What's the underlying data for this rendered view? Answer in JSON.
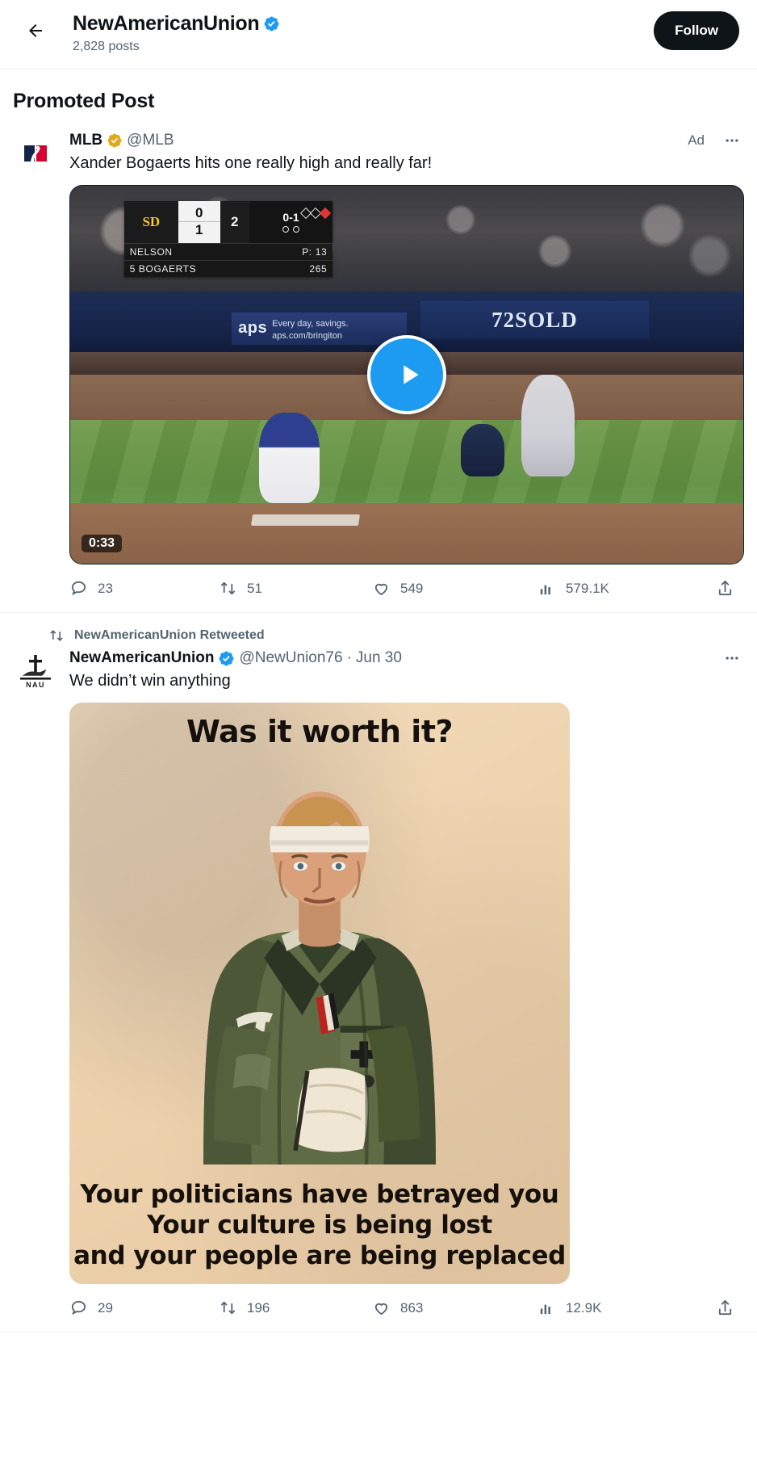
{
  "header": {
    "back_icon": "arrow-left-icon",
    "name": "NewAmericanUnion",
    "verified_badge": "verified-blue-icon",
    "post_count": "2,828 posts",
    "follow_label": "Follow"
  },
  "promoted_heading": "Promoted Post",
  "colors": {
    "accent_blue": "#1d9bf0",
    "verified_blue": "#1d9bf0",
    "verified_gold": "#e0a91c",
    "text_primary": "#0f1419",
    "text_secondary": "#536471",
    "follow_bg": "#0f1419"
  },
  "posts": [
    {
      "id": "promoted-mlb",
      "avatar_icon": "mlb-logo-icon",
      "display_name": "MLB",
      "badge": "verified-gold-icon",
      "handle": "@MLB",
      "ad_label": "Ad",
      "more_icon": "more-options-icon",
      "text": "Xander Bogaerts hits one really high and really far!",
      "media": {
        "type": "video",
        "duration": "0:33",
        "play_icon": "play-button-icon",
        "scoreboard": {
          "team_mark": "SD",
          "score_away": "0",
          "score_home": "1",
          "inning": "2",
          "count": "0-1",
          "pitcher_name": "NELSON",
          "pitcher_stat_label": "P:",
          "pitcher_stat_value": "13",
          "batter_name": "5  BOGAERTS",
          "batter_stat": "265"
        },
        "signage": {
          "outfield_sign": "72SOLD",
          "sponsor_name": "aps",
          "sponsor_tagline": "Every day, savings.",
          "sponsor_url": "aps.com/bringiton"
        }
      },
      "actions": {
        "reply_icon": "reply-icon",
        "reply_count": "23",
        "repost_icon": "repost-icon",
        "repost_count": "51",
        "like_icon": "heart-icon",
        "like_count": "549",
        "views_icon": "analytics-icon",
        "views_count": "579.1K",
        "share_icon": "share-icon"
      }
    },
    {
      "id": "retweet-nau",
      "retweet_context": "NewAmericanUnion Retweeted",
      "retweet_icon": "repost-icon",
      "avatar_icon": "nau-logo-icon",
      "avatar_text": "NAU",
      "display_name": "NewAmericanUnion",
      "badge": "verified-blue-icon",
      "handle": "@NewUnion76",
      "separator": "·",
      "date": "Jun 30",
      "more_icon": "more-options-icon",
      "text": "We didn’t win anything",
      "media": {
        "type": "image",
        "alt": "illustration-wounded-soldier",
        "top_caption": "Was it worth it?",
        "bottom_caption_line1": "Your politicians have betrayed you",
        "bottom_caption_line2": "Your culture is being lost",
        "bottom_caption_line3": "and your people are being replaced"
      },
      "actions": {
        "reply_icon": "reply-icon",
        "reply_count": "29",
        "repost_icon": "repost-icon",
        "repost_count": "196",
        "like_icon": "heart-icon",
        "like_count": "863",
        "views_icon": "analytics-icon",
        "views_count": "12.9K",
        "share_icon": "share-icon"
      }
    }
  ]
}
